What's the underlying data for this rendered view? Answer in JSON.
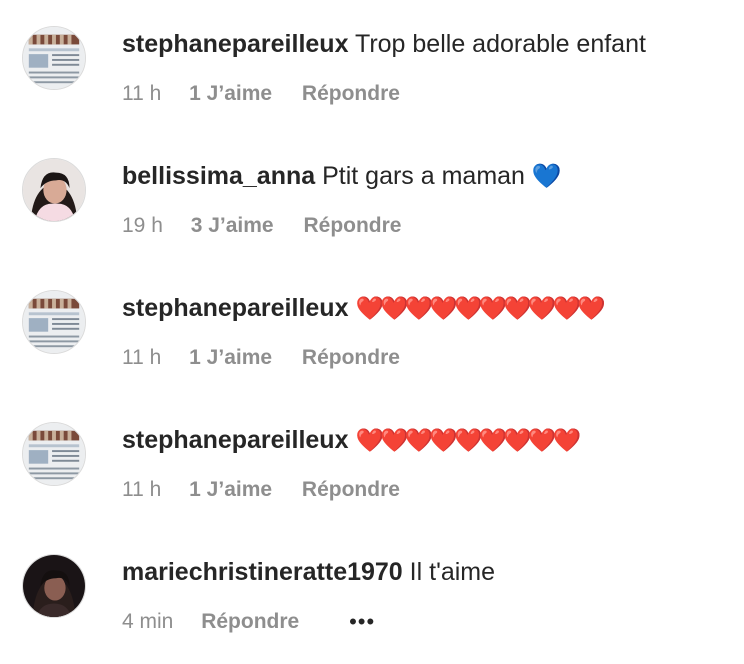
{
  "comments": [
    {
      "username": "stephanepareilleux",
      "text": "Trop belle adorable enfant",
      "time": "11 h",
      "likes": "1 J’aime",
      "reply": "Répondre",
      "avatar_icon": "screenshot-thumbnail-avatar"
    },
    {
      "username": "bellissima_anna",
      "text": "Ptit gars a maman",
      "emoji": "💙",
      "time": "19 h",
      "likes": "3 J’aime",
      "reply": "Répondre",
      "avatar_icon": "woman-photo-avatar"
    },
    {
      "username": "stephanepareilleux",
      "text": "❤️❤️❤️❤️❤️❤️❤️❤️❤️❤️",
      "time": "11 h",
      "likes": "1 J’aime",
      "reply": "Répondre",
      "avatar_icon": "screenshot-thumbnail-avatar"
    },
    {
      "username": "stephanepareilleux",
      "text": "❤️❤️❤️❤️❤️❤️❤️❤️❤️",
      "time": "11 h",
      "likes": "1 J’aime",
      "reply": "Répondre",
      "avatar_icon": "screenshot-thumbnail-avatar"
    },
    {
      "username": "mariechristineratte1970",
      "text": "Il t'aime",
      "time": "4 min",
      "reply": "Répondre",
      "more": "•••",
      "avatar_icon": "dark-photo-avatar"
    }
  ],
  "colors": {
    "text": "#262626",
    "secondary": "#8e8e8e",
    "heart_red": "#ed1b2e",
    "heart_blue": "#2a7de1"
  }
}
